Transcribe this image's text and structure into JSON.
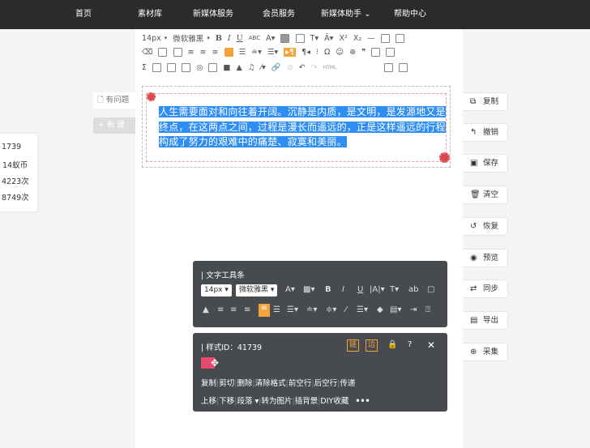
{
  "nav": {
    "items": [
      "首页",
      "素材库",
      "新媒体服务",
      "会员服务",
      "新媒体助手",
      "帮助中心"
    ]
  },
  "left_panel": {
    "rows": [
      "1739",
      "14蚁币",
      "4223次",
      "8749次"
    ]
  },
  "side_left": {
    "problem_label": "有问题",
    "new_label": "+ 新 建"
  },
  "toolbar": {
    "font_size": "14px",
    "font_family": "微软雅黑",
    "html_label": "HTML"
  },
  "content": {
    "text": "人生需要面对和向往着开阔。沉静是内质，是文明，是发源地又是终点，在这两点之间，过程是漫长而遥远的，正是这样遥远的行程构成了努力的艰难中的痛楚、寂寞和美丽。"
  },
  "right_buttons": [
    {
      "icon": "copy-icon",
      "label": "复制"
    },
    {
      "icon": "undo-icon",
      "label": "撤销"
    },
    {
      "icon": "save-icon",
      "label": "保存"
    },
    {
      "icon": "trash-icon",
      "label": "清空"
    },
    {
      "icon": "restore-icon",
      "label": "恢复"
    },
    {
      "icon": "eye-icon",
      "label": "预览"
    },
    {
      "icon": "sync-icon",
      "label": "同步"
    },
    {
      "icon": "export-icon",
      "label": "导出"
    },
    {
      "icon": "collect-icon",
      "label": "采集"
    }
  ],
  "text_toolbar": {
    "title": "文字工具条",
    "font_size": "14px",
    "font_family": "微软雅黑"
  },
  "style_bar": {
    "title": "样式ID：41739",
    "chain_label": "链",
    "edge_label": "边",
    "actions_row1": [
      "复制",
      "剪切",
      "删除",
      "清除格式",
      "前空行",
      "后空行",
      "传递"
    ],
    "actions_row2": [
      "上移",
      "下移",
      "段落",
      "转为图片",
      "插背景",
      "DIY收藏"
    ]
  },
  "colors": {
    "nav_bg": "#2b2b2b",
    "accent": "#f3a33a",
    "selection": "#2f8ef4",
    "panel_bg": "#474b4f"
  }
}
